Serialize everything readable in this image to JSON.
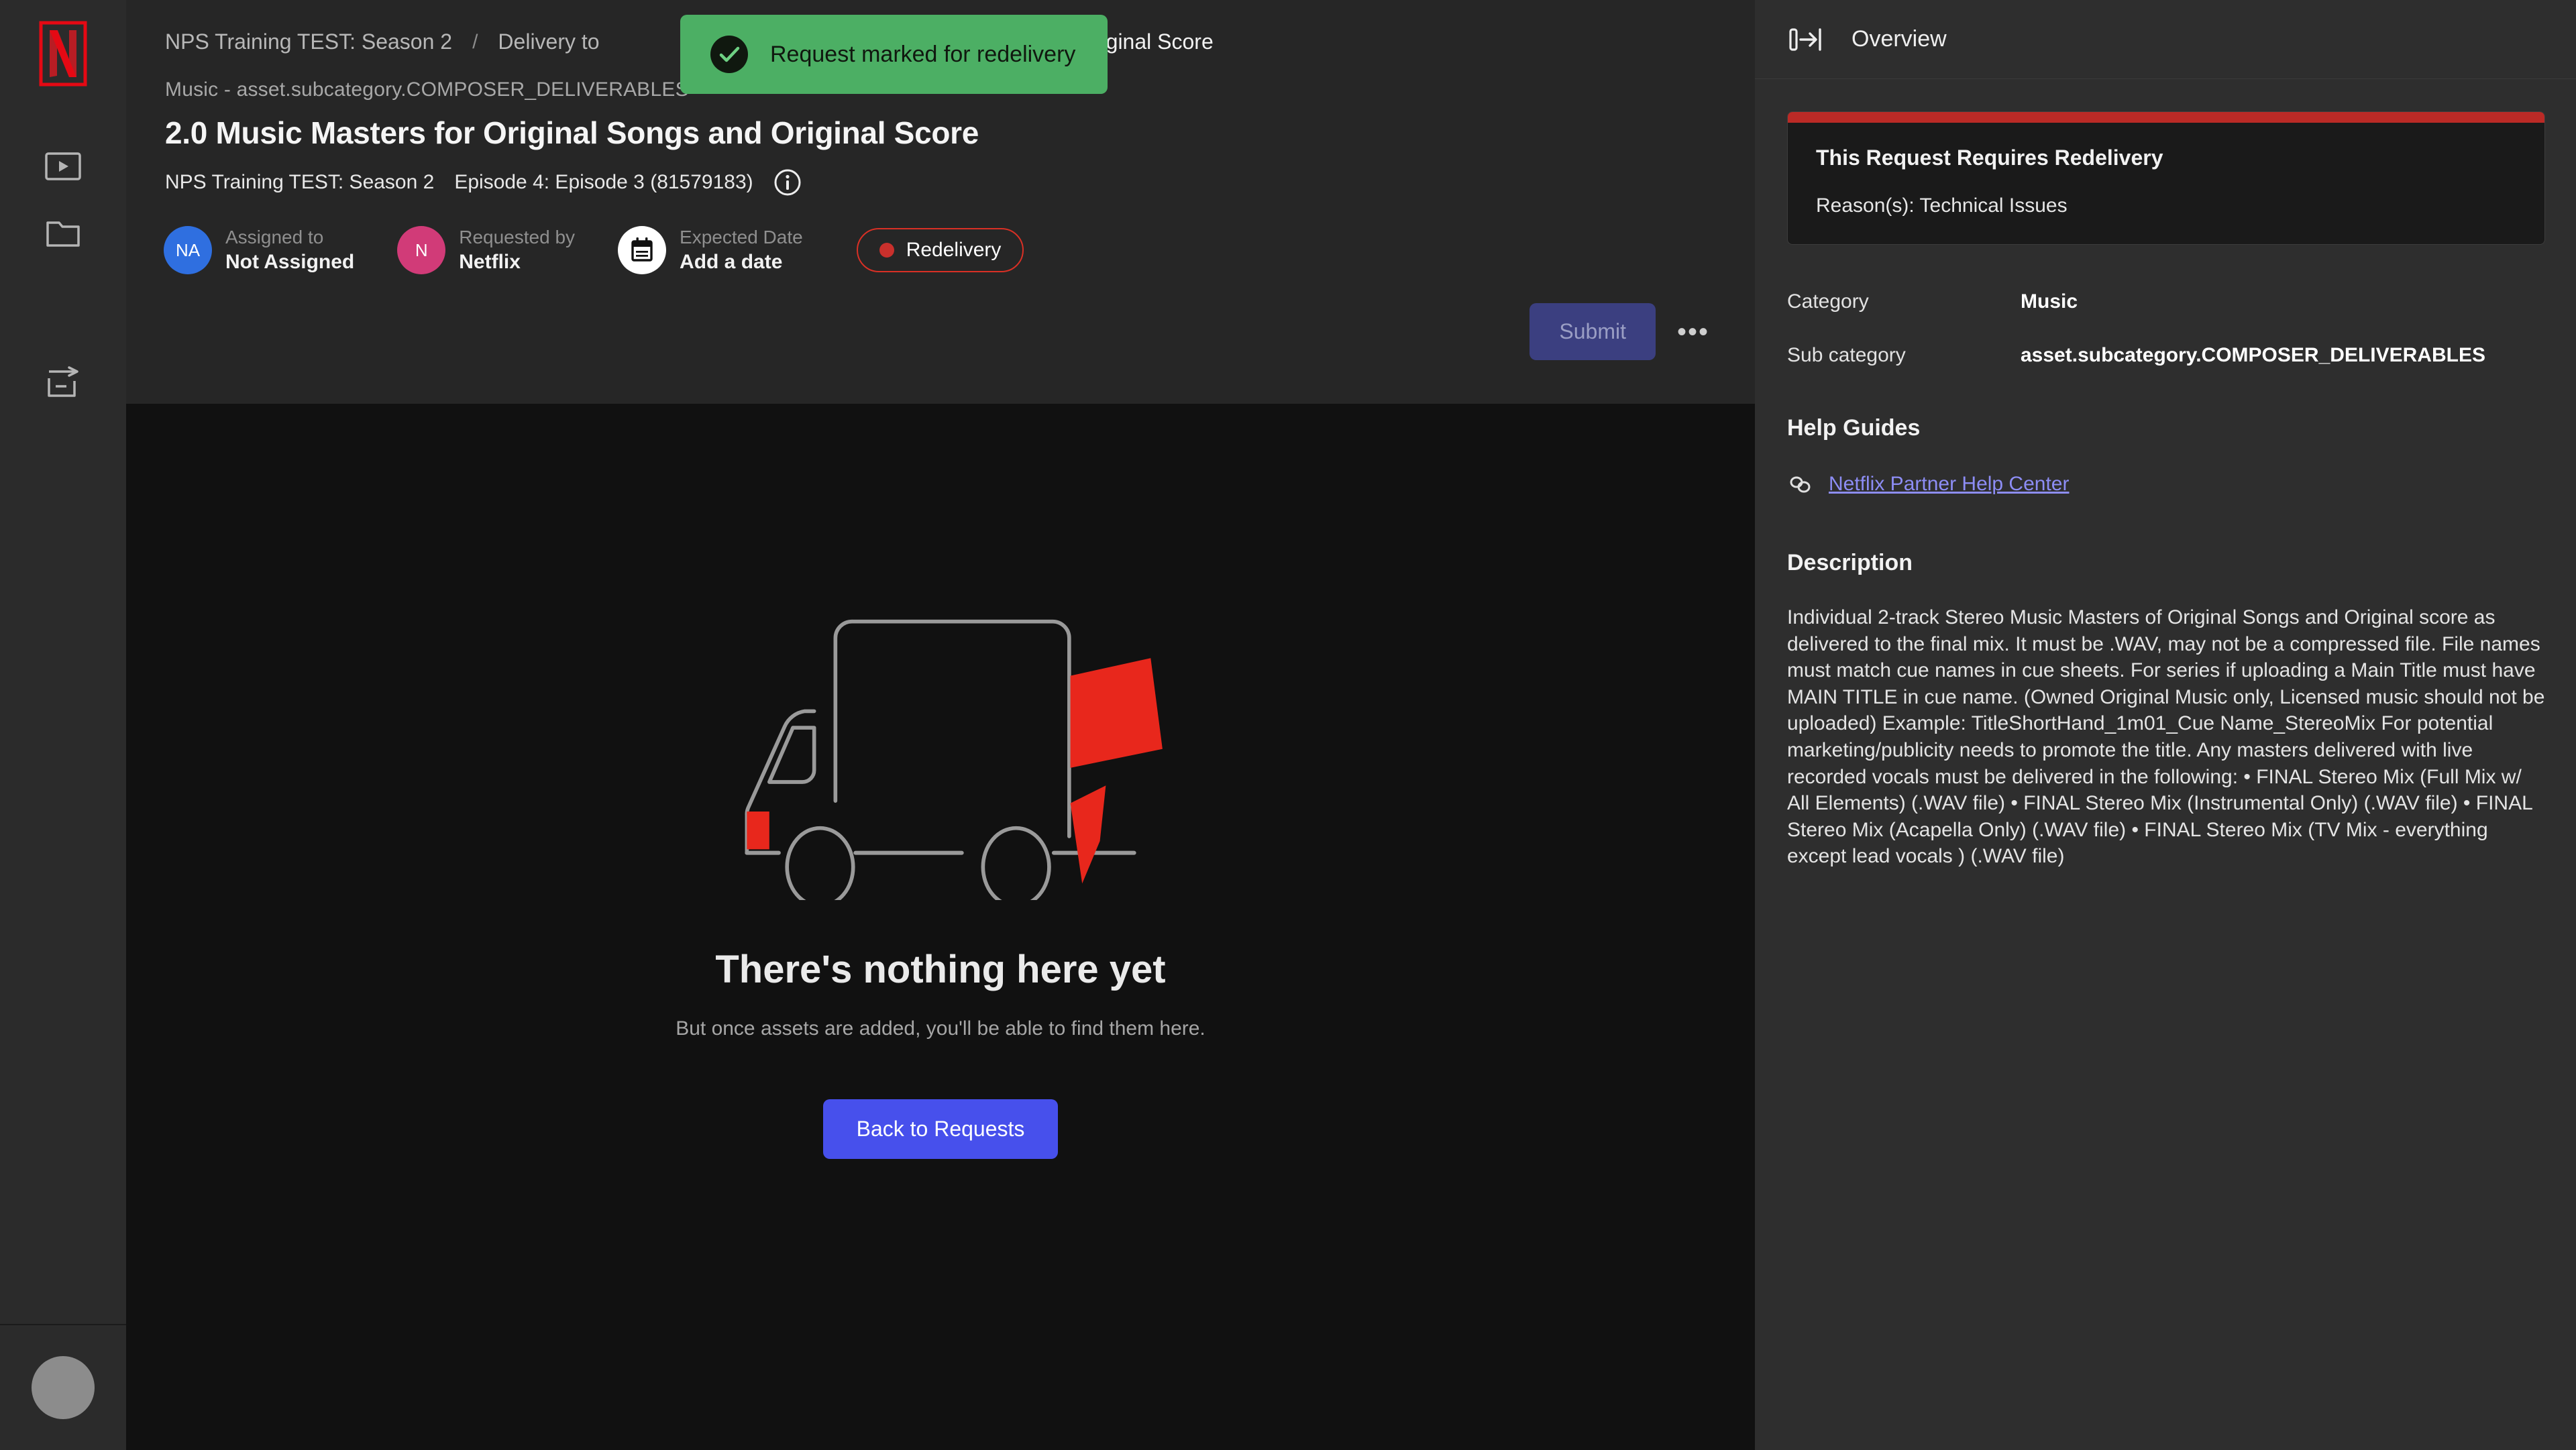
{
  "toast": {
    "message": "Request marked for redelivery",
    "icon": "check-circle-icon",
    "bg_color": "#4caf64"
  },
  "sidebar": {
    "logo": "netflix-logo",
    "items": [
      {
        "icon": "video-box-icon",
        "name": "media"
      },
      {
        "icon": "folder-icon",
        "name": "folders"
      },
      {
        "icon": "box-arrow-out-icon",
        "name": "deliveries"
      }
    ],
    "avatar": "user-avatar"
  },
  "breadcrumb": {
    "items": [
      {
        "label": "NPS Training TEST: Season 2"
      },
      {
        "label": "Delivery to"
      },
      {
        "label": "ginal Songs and Original Score"
      }
    ],
    "separator": "/"
  },
  "header": {
    "category_line": "Music - asset.subcategory.COMPOSER_DELIVERABLES",
    "title": "2.0 Music Masters for Original Songs and Original Score",
    "series": "NPS Training TEST: Season 2",
    "episode": "Episode 4: Episode 3 (81579183)",
    "info_icon": "info-circle-icon",
    "meta": [
      {
        "initials": "NA",
        "avatar_color": "#2f6fe0",
        "label": "Assigned to",
        "value": "Not Assigned"
      },
      {
        "initials": "N",
        "avatar_color": "#d13b78",
        "label": "Requested by",
        "value": "Netflix"
      },
      {
        "initials": "",
        "avatar_color": "#ffffff",
        "label": "Expected Date",
        "value": "Add a date",
        "icon": "calendar-icon"
      }
    ],
    "status_pill": {
      "label": "Redelivery",
      "dot_color": "#c9302c",
      "border_color": "#d93025"
    },
    "submit_label": "Submit",
    "more_label": "•••"
  },
  "empty_state": {
    "illustration": "delivery-truck-illustration",
    "title": "There's nothing here yet",
    "subtitle": "But once assets are added, you'll be able to find them here.",
    "button_label": "Back to Requests",
    "button_color": "#4750ec"
  },
  "panel": {
    "title": "Overview",
    "collapse_icon": "collapse-panel-right-icon",
    "alert": {
      "accent_color": "#bb2a26",
      "title": "This Request Requires Redelivery",
      "reason": "Reason(s): Technical Issues"
    },
    "fields": [
      {
        "key": "Category",
        "value": "Music"
      },
      {
        "key": "Sub category",
        "value": "asset.subcategory.COMPOSER_DELIVERABLES"
      }
    ],
    "help_guides": {
      "heading": "Help Guides",
      "link_icon": "link-chain-icon",
      "link_label": "Netflix Partner Help Center",
      "link_color": "#8d8df5"
    },
    "description": {
      "heading": "Description",
      "body": "Individual 2-track Stereo Music Masters of Original Songs and Original score as delivered to the final mix. It must be .WAV, may not be a compressed file. File names must match cue names in cue sheets. For series if uploading a Main Title must have MAIN TITLE in cue name. (Owned Original Music only, Licensed music should not be uploaded) Example: TitleShortHand_1m01_Cue Name_StereoMix For potential marketing/publicity needs to promote the title. Any masters delivered with live recorded vocals must be delivered in the following: • FINAL Stereo Mix (Full Mix w/ All Elements) (.WAV file) • FINAL Stereo Mix (Instrumental Only) (.WAV file) • FINAL Stereo Mix (Acapella Only) (.WAV file) • FINAL Stereo Mix (TV Mix - everything except lead vocals ) (.WAV file)"
    }
  }
}
